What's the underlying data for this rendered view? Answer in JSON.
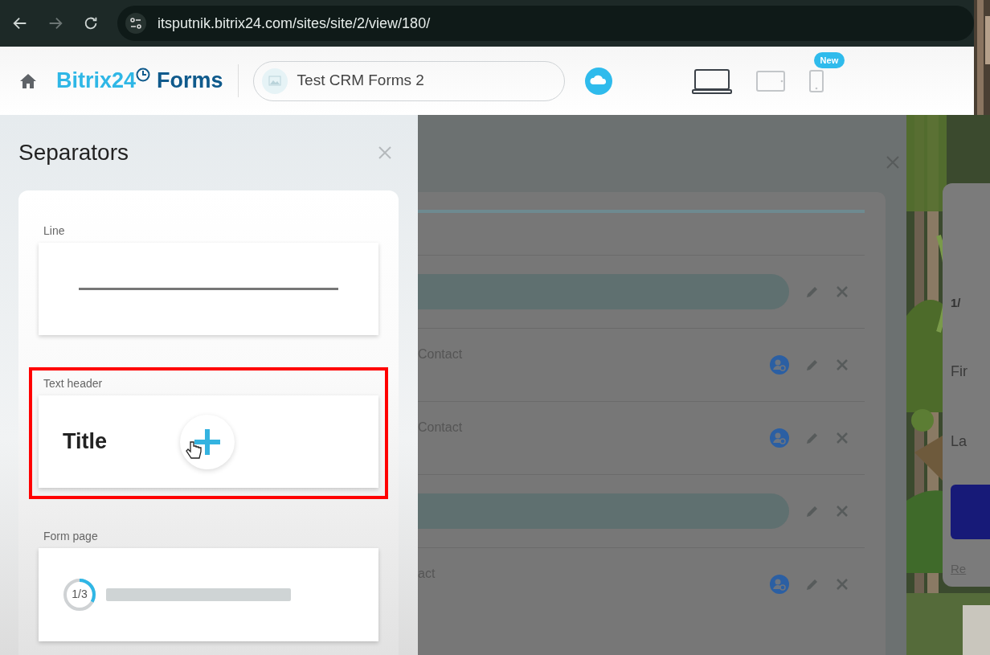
{
  "browser": {
    "url": "itsputnik.bitrix24.com/sites/site/2/view/180/"
  },
  "header": {
    "logo_brand": "Bitrix24",
    "logo_product": "Forms",
    "site_name": "Test CRM Forms 2",
    "devices": [
      {
        "kind": "laptop",
        "selected": true
      },
      {
        "kind": "tablet",
        "selected": false
      },
      {
        "kind": "phone",
        "selected": false,
        "badge": "New"
      }
    ]
  },
  "panel": {
    "title": "Separators",
    "items": [
      {
        "kind": "line",
        "label": "Line",
        "highlighted": false,
        "hovered": false
      },
      {
        "kind": "header",
        "label": "Text header",
        "preview_text": "Title",
        "highlighted": true,
        "hovered": true
      },
      {
        "kind": "page",
        "label": "Form page",
        "step": "1/3",
        "level": 0.33,
        "highlighted": false,
        "hovered": false
      }
    ]
  },
  "editor": {
    "rows": [
      {
        "kind": "bar",
        "contact_search": false
      },
      {
        "kind": "field",
        "text": "Contact",
        "contact_search": true
      },
      {
        "kind": "field",
        "text": "Contact",
        "contact_search": true
      },
      {
        "kind": "bar",
        "contact_search": false
      },
      {
        "kind": "field",
        "text": "act",
        "contact_search": true
      }
    ]
  },
  "form_preview": {
    "step": "1/",
    "fields": [
      "Fir",
      "La"
    ],
    "link": "Re"
  }
}
